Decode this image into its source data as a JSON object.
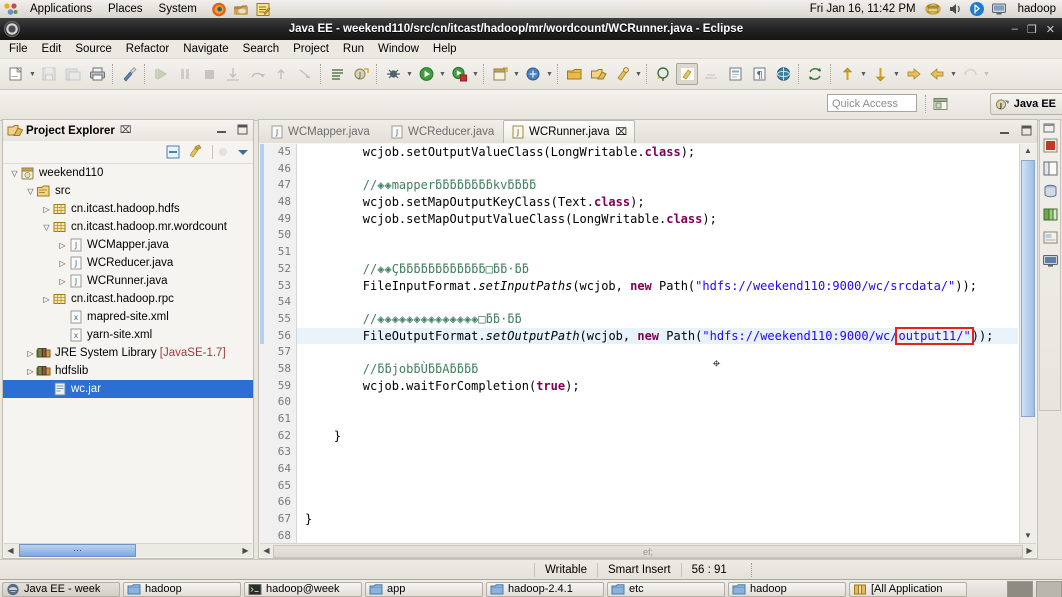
{
  "desktop": {
    "panel": {
      "menus": [
        "Applications",
        "Places",
        "System"
      ],
      "launchers": [
        "firefox-icon",
        "files-icon",
        "text-editor-icon"
      ],
      "clock": "Fri Jan 16, 11:42 PM",
      "tray": [
        "archive-manager-icon",
        "volume-icon",
        "bluetooth-icon",
        "display-icon"
      ],
      "user": "hadoop"
    },
    "taskbar": {
      "items": [
        {
          "label": "Java EE - week",
          "icon": "eclipse-icon",
          "active": true
        },
        {
          "label": "hadoop",
          "icon": "folder-icon",
          "active": false
        },
        {
          "label": "hadoop@week",
          "icon": "terminal-icon",
          "active": false
        },
        {
          "label": "app",
          "icon": "folder-icon",
          "active": false
        },
        {
          "label": "hadoop-2.4.1",
          "icon": "folder-icon",
          "active": false
        },
        {
          "label": "etc",
          "icon": "folder-icon",
          "active": false
        },
        {
          "label": "hadoop",
          "icon": "folder-icon",
          "active": false
        },
        {
          "label": "[All Application",
          "icon": "archive-icon",
          "active": false
        }
      ]
    }
  },
  "window": {
    "title": "Java EE - weekend110/src/cn/itcast/hadoop/mr/wordcount/WCRunner.java - Eclipse",
    "buttons": {
      "minimize": "–",
      "maximize": "❐",
      "close": "✕"
    }
  },
  "menubar": [
    "File",
    "Edit",
    "Source",
    "Refactor",
    "Navigate",
    "Search",
    "Project",
    "Run",
    "Window",
    "Help"
  ],
  "toolbar": {
    "groups": [
      {
        "items": [
          {
            "icon": "new-wizard-icon",
            "dropdown": true,
            "enabled": true
          },
          {
            "icon": "save-icon",
            "dropdown": false,
            "enabled": false
          },
          {
            "icon": "save-all-icon",
            "dropdown": false,
            "enabled": false
          },
          {
            "icon": "print-icon",
            "dropdown": false,
            "enabled": true
          }
        ]
      },
      {
        "items": [
          {
            "icon": "build-clean-icon",
            "dropdown": false,
            "enabled": true
          }
        ]
      },
      {
        "items": [
          {
            "icon": "resume-icon",
            "dropdown": false,
            "enabled": false
          },
          {
            "icon": "suspend-icon",
            "dropdown": false,
            "enabled": false
          },
          {
            "icon": "terminate-icon",
            "dropdown": false,
            "enabled": false
          },
          {
            "icon": "step-into-icon",
            "dropdown": false,
            "enabled": false
          },
          {
            "icon": "step-over-icon",
            "dropdown": false,
            "enabled": false
          },
          {
            "icon": "step-return-icon",
            "dropdown": false,
            "enabled": false
          },
          {
            "icon": "drop-to-frame-icon",
            "dropdown": false,
            "enabled": false
          }
        ]
      },
      {
        "items": [
          {
            "icon": "open-task-icon",
            "dropdown": false,
            "enabled": true
          },
          {
            "icon": "new-java-class-icon",
            "dropdown": false,
            "enabled": true
          }
        ]
      },
      {
        "items": [
          {
            "icon": "debug-icon",
            "dropdown": true,
            "enabled": true
          },
          {
            "icon": "run-icon",
            "dropdown": true,
            "enabled": true
          },
          {
            "icon": "run-external-tools-icon",
            "dropdown": true,
            "enabled": true
          }
        ]
      },
      {
        "items": [
          {
            "icon": "new-java-project-icon",
            "dropdown": true,
            "enabled": true
          },
          {
            "icon": "new-ejb-project-icon",
            "dropdown": false,
            "enabled": true
          },
          {
            "icon": "new-package-icon",
            "dropdown": true,
            "enabled": true
          }
        ]
      },
      {
        "items": [
          {
            "icon": "open-type-icon",
            "dropdown": false,
            "enabled": true
          },
          {
            "icon": "open-folder-icon",
            "dropdown": false,
            "enabled": true
          },
          {
            "icon": "search-icon",
            "dropdown": true,
            "enabled": true
          }
        ]
      },
      {
        "items": [
          {
            "icon": "link-with-editor-icon",
            "dropdown": false,
            "enabled": true
          },
          {
            "icon": "toggle-mark-occurrences-icon",
            "dropdown": false,
            "enabled": true,
            "selected": true
          },
          {
            "icon": "show-whitespace-icon",
            "dropdown": false,
            "enabled": false
          },
          {
            "icon": "block-selection-icon",
            "dropdown": false,
            "enabled": true
          },
          {
            "icon": "pilcrow-icon",
            "dropdown": false,
            "enabled": true
          },
          {
            "icon": "web-browser-icon",
            "dropdown": false,
            "enabled": true
          }
        ]
      },
      {
        "items": [
          {
            "icon": "sync-icon",
            "dropdown": false,
            "enabled": true
          }
        ]
      },
      {
        "items": [
          {
            "icon": "annotation-prev-icon",
            "dropdown": true,
            "enabled": true
          },
          {
            "icon": "annotation-next-icon",
            "dropdown": true,
            "enabled": true
          },
          {
            "icon": "forward-history-icon",
            "dropdown": false,
            "enabled": true
          },
          {
            "icon": "back-history-icon",
            "dropdown": true,
            "enabled": true
          },
          {
            "icon": "undo-nav-icon",
            "dropdown": true,
            "enabled": false
          }
        ]
      }
    ],
    "quick_access_placeholder": "Quick Access",
    "new-perspective-icon": "new-perspective-icon",
    "perspective": {
      "label": "Java EE",
      "icon": "java-ee-perspective-icon"
    }
  },
  "project_explorer": {
    "title": "Project Explorer",
    "close_glyph": "⌧",
    "minimize_glyph": "minimize-icon",
    "maximize_glyph": "maximize-icon",
    "toolbar": [
      "collapse-all-icon",
      "link-with-editor-icon",
      "focus-icon",
      "view-menu-icon"
    ],
    "tree": [
      {
        "depth": 0,
        "arrow": "open",
        "icon": "java-project-icon",
        "label": "weekend110",
        "selected": false
      },
      {
        "depth": 1,
        "arrow": "open",
        "icon": "source-folder-icon",
        "label": "src",
        "selected": false
      },
      {
        "depth": 2,
        "arrow": "closed",
        "icon": "package-icon",
        "label": "cn.itcast.hadoop.hdfs",
        "selected": false
      },
      {
        "depth": 2,
        "arrow": "open",
        "icon": "package-icon",
        "label": "cn.itcast.hadoop.mr.wordcount",
        "selected": false
      },
      {
        "depth": 3,
        "arrow": "closed",
        "icon": "java-file-icon",
        "label": "WCMapper.java",
        "selected": false
      },
      {
        "depth": 3,
        "arrow": "closed",
        "icon": "java-file-icon",
        "label": "WCReducer.java",
        "selected": false
      },
      {
        "depth": 3,
        "arrow": "closed",
        "icon": "java-file-icon",
        "label": "WCRunner.java",
        "selected": false
      },
      {
        "depth": 2,
        "arrow": "closed",
        "icon": "package-icon",
        "label": "cn.itcast.hadoop.rpc",
        "selected": false
      },
      {
        "depth": 3,
        "arrow": "none",
        "icon": "xml-file-icon",
        "label": "mapred-site.xml",
        "selected": false
      },
      {
        "depth": 3,
        "arrow": "none",
        "icon": "xml-file-icon",
        "label": "yarn-site.xml",
        "selected": false
      },
      {
        "depth": 1,
        "arrow": "closed",
        "icon": "library-icon",
        "label": "JRE System Library",
        "dim": " [JavaSE-1.7]",
        "selected": false
      },
      {
        "depth": 1,
        "arrow": "closed",
        "icon": "library-icon",
        "label": "hdfslib",
        "selected": false
      },
      {
        "depth": 2,
        "arrow": "none",
        "icon": "jar-icon",
        "label": "wc.jar",
        "selected": true
      }
    ],
    "hscroll_thumb_label": "⋯"
  },
  "editor": {
    "tabs": [
      {
        "label": "WCMapper.java",
        "icon": "java-file-icon",
        "active": false,
        "closeable": false
      },
      {
        "label": "WCReducer.java",
        "icon": "java-file-icon",
        "active": false,
        "closeable": false
      },
      {
        "label": "WCRunner.java",
        "icon": "java-file-active-icon",
        "active": true,
        "closeable": true,
        "close_glyph": "⌧"
      }
    ],
    "controls": [
      "restore-icon",
      "maximize-icon"
    ],
    "first_line": 45,
    "highlight_line": 56,
    "lines": [
      {
        "n": 45,
        "segments": [
          {
            "t": "        wcjob.setOutputValueClass(LongWritable.",
            "c": "plain"
          },
          {
            "t": "class",
            "c": "kw"
          },
          {
            "t": ");",
            "c": "plain"
          }
        ]
      },
      {
        "n": 46,
        "segments": []
      },
      {
        "n": 47,
        "segments": [
          {
            "t": "        //◈◈mapperƃƃƃƃƃƃƃƃkvƃƃƃƃ",
            "c": "cmt"
          }
        ]
      },
      {
        "n": 48,
        "segments": [
          {
            "t": "        wcjob.setMapOutputKeyClass(Text.",
            "c": "plain"
          },
          {
            "t": "class",
            "c": "kw"
          },
          {
            "t": ");",
            "c": "plain"
          }
        ]
      },
      {
        "n": 49,
        "segments": [
          {
            "t": "        wcjob.setMapOutputValueClass(LongWritable.",
            "c": "plain"
          },
          {
            "t": "class",
            "c": "kw"
          },
          {
            "t": ");",
            "c": "plain"
          }
        ]
      },
      {
        "n": 50,
        "segments": []
      },
      {
        "n": 51,
        "segments": []
      },
      {
        "n": 52,
        "segments": [
          {
            "t": "        //◈◈Çƃƃƃƃƃƃƃƃƃƃƃƃ□ƃƃ·ƃƃ",
            "c": "cmt"
          }
        ]
      },
      {
        "n": 53,
        "segments": [
          {
            "t": "        FileInputFormat.",
            "c": "plain"
          },
          {
            "t": "setInputPaths",
            "c": "itl"
          },
          {
            "t": "(wcjob, ",
            "c": "plain"
          },
          {
            "t": "new",
            "c": "kw"
          },
          {
            "t": " Path(",
            "c": "plain"
          },
          {
            "t": "\"hdfs://weekend110:9000/wc/srcdata/\"",
            "c": "str"
          },
          {
            "t": "));",
            "c": "plain"
          }
        ]
      },
      {
        "n": 54,
        "segments": []
      },
      {
        "n": 55,
        "segments": [
          {
            "t": "        //◈◈◈◈◈◈◈◈◈◈◈◈◈◈□ƃƃ·ƃƃ",
            "c": "cmt"
          }
        ]
      },
      {
        "n": 56,
        "segments": [
          {
            "t": "        FileOutputFormat.",
            "c": "plain"
          },
          {
            "t": "setOutputPath",
            "c": "itl"
          },
          {
            "t": "(wcjob, ",
            "c": "plain"
          },
          {
            "t": "new",
            "c": "kw"
          },
          {
            "t": " Path(",
            "c": "plain"
          },
          {
            "t": "\"hdfs://weekend110:9000/wc/",
            "c": "str"
          },
          {
            "t": "output11/\"",
            "c": "str-boxed"
          },
          {
            "t": "));",
            "c": "plain"
          }
        ]
      },
      {
        "n": 57,
        "segments": []
      },
      {
        "n": 58,
        "segments": [
          {
            "t": "        //ƃƃjobƃÙƃƃAƃƃƃƃ",
            "c": "cmt"
          }
        ]
      },
      {
        "n": 59,
        "segments": [
          {
            "t": "        wcjob.waitForCompletion(",
            "c": "plain"
          },
          {
            "t": "true",
            "c": "kw"
          },
          {
            "t": ");",
            "c": "plain"
          }
        ]
      },
      {
        "n": 60,
        "segments": []
      },
      {
        "n": 61,
        "segments": []
      },
      {
        "n": 62,
        "segments": [
          {
            "t": "    }",
            "c": "plain"
          }
        ]
      },
      {
        "n": 63,
        "segments": []
      },
      {
        "n": 64,
        "segments": []
      },
      {
        "n": 65,
        "segments": []
      },
      {
        "n": 66,
        "segments": []
      },
      {
        "n": 67,
        "segments": [
          {
            "t": "}",
            "c": "plain"
          }
        ]
      },
      {
        "n": 68,
        "segments": []
      }
    ]
  },
  "fastview": [
    "fastview-menu-icon",
    "servers-icon",
    "outline-icon",
    "data-source-icon",
    "snippets-icon",
    "palette-icon",
    "console-icon"
  ],
  "statusbar": {
    "writable": "Writable",
    "insert_mode": "Smart Insert",
    "cursor_position": "56 : 91"
  },
  "colors": {
    "selection_blue": "#2b6ed4",
    "highlight_box_red": "#e2231a",
    "string_blue": "#2a00ff",
    "keyword_purple": "#7f0055",
    "comment_green": "#3f7f5f",
    "line_highlight": "#e8f2fb"
  }
}
